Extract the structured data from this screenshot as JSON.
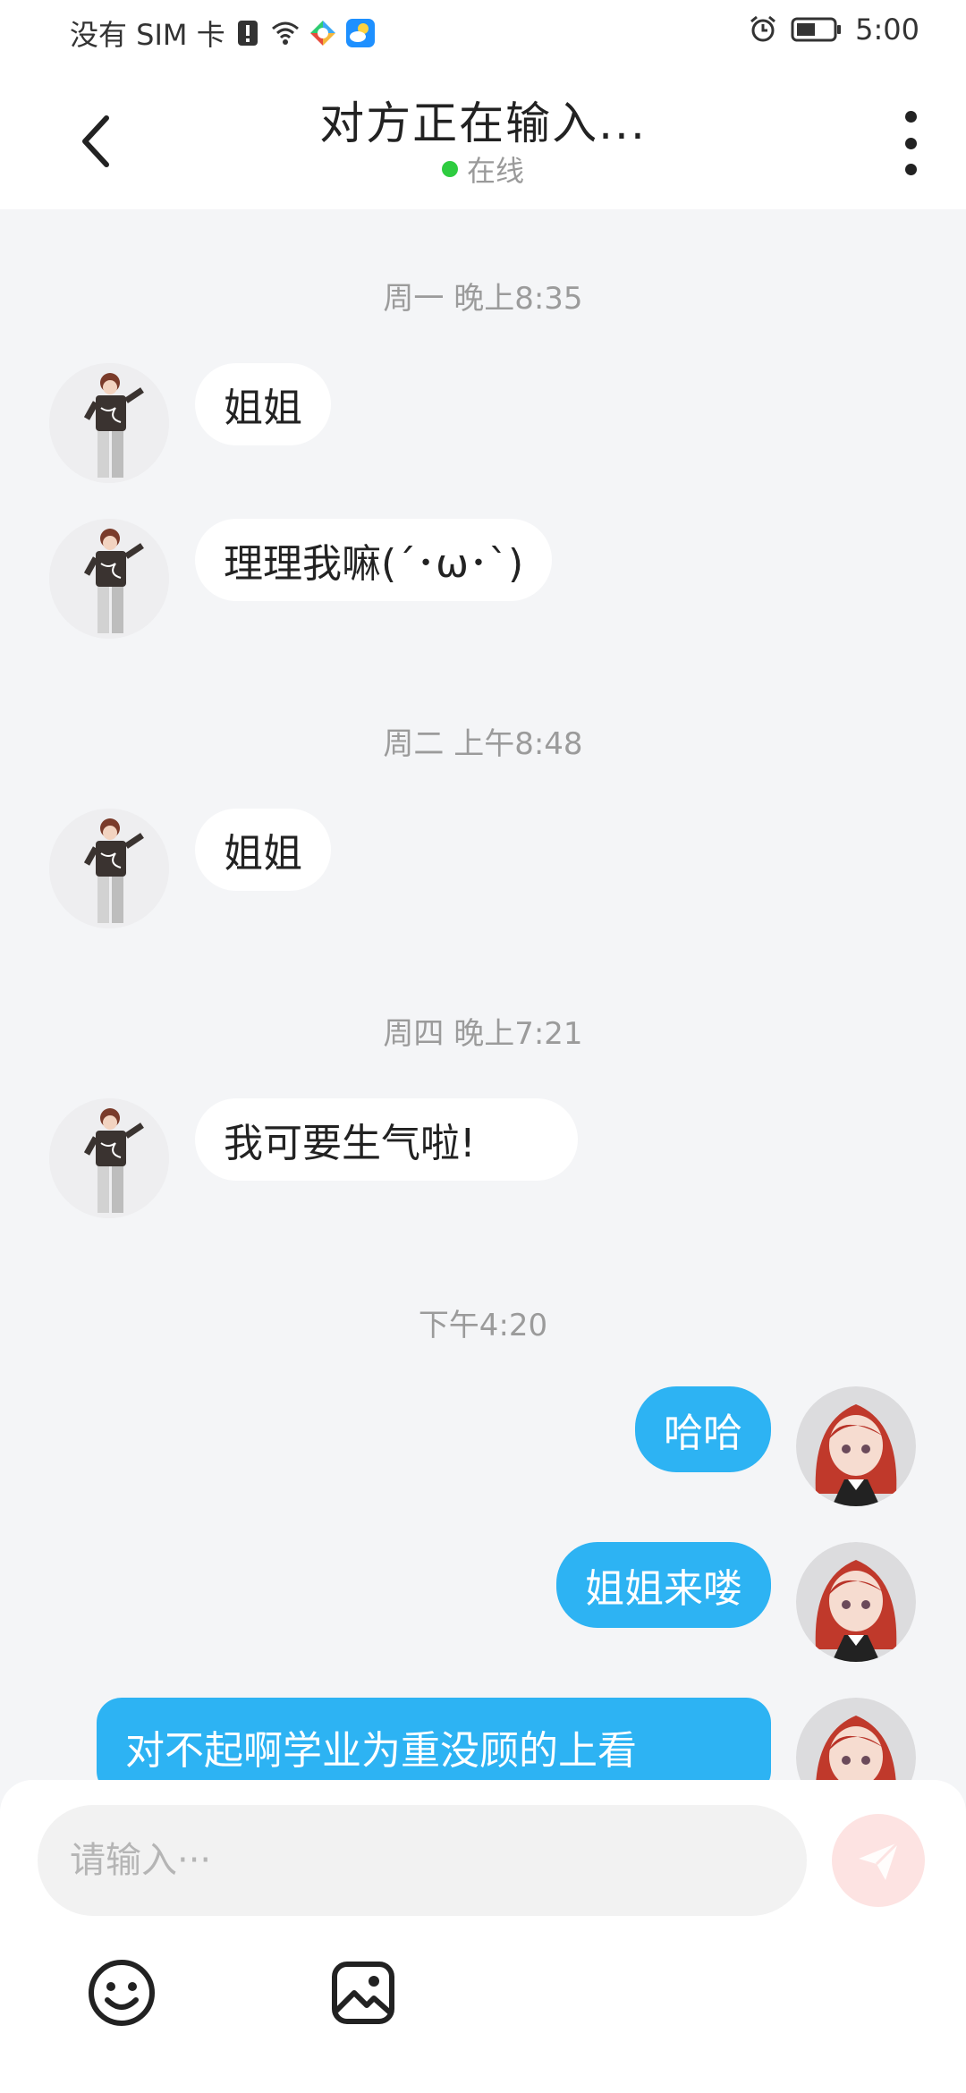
{
  "status_bar": {
    "carrier": "没有 SIM 卡",
    "time": "5:00",
    "icons": [
      "sim-alert-icon",
      "wifi-icon",
      "app-colorful-icon",
      "weather-icon",
      "alarm-icon",
      "battery-icon"
    ]
  },
  "header": {
    "title": "对方正在输入...",
    "status": "在线",
    "status_color": "#2ecc40"
  },
  "messages": [
    {
      "type": "timestamp",
      "text": "周一 晚上8:35"
    },
    {
      "type": "in",
      "text": "姐姐"
    },
    {
      "type": "in",
      "text": "理理我嘛(´･ω･`)"
    },
    {
      "type": "timestamp",
      "text": "周二 上午8:48"
    },
    {
      "type": "in",
      "text": "姐姐"
    },
    {
      "type": "timestamp",
      "text": "周四 晚上7:21"
    },
    {
      "type": "in",
      "text": "我可要生气啦!"
    },
    {
      "type": "timestamp",
      "text": "下午4:20"
    },
    {
      "type": "out",
      "text": "哈哈"
    },
    {
      "type": "out",
      "text": "姐姐来喽"
    },
    {
      "type": "out",
      "text": "对不起啊学业为重没顾的上看"
    }
  ],
  "composer": {
    "placeholder": "请输入···",
    "send_icon": "paper-plane-icon",
    "tools": [
      "emoji-icon",
      "image-icon"
    ]
  },
  "colors": {
    "accent": "#2db3f3",
    "background": "#f4f5f7",
    "send_button": "#fde3e2"
  }
}
